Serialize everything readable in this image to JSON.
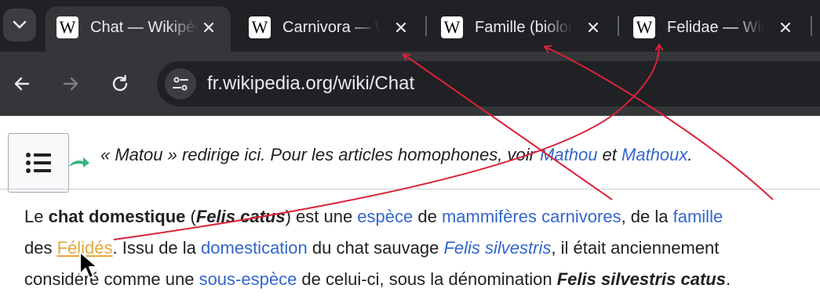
{
  "tabs": [
    {
      "title": "Chat — Wikipédia",
      "active": true
    },
    {
      "title": "Carnivora — Wikipédia",
      "active": false
    },
    {
      "title": "Famille (biologie) — Wikipédia",
      "active": false
    },
    {
      "title": "Felidae — Wikipédia",
      "active": false
    }
  ],
  "favicon_glyph": "W",
  "toolbar": {
    "url": "fr.wikipedia.org/wiki/Chat"
  },
  "hatnote": {
    "prefix": "« Matou » redirige ici. Pour les articles homophones, voir ",
    "link1": "Mathou",
    "mid": " et ",
    "link2": "Mathoux",
    "suffix": "."
  },
  "paragraph": {
    "l1_a": "Le ",
    "l1_b": "chat domestique",
    "l1_c": " (",
    "l1_d": "Felis catus",
    "l1_e": ") est une ",
    "l1_link1": "espèce",
    "l1_f": " de ",
    "l1_link2": "mammifères",
    "l1_g": " ",
    "l1_link3": "carnivores",
    "l1_h": ", de la ",
    "l1_link4": "famille",
    "l2_a": "des ",
    "l2_link1": "Félidés",
    "l2_b": ". Issu de la ",
    "l2_link2": "domestication",
    "l2_c": " du chat sauvage ",
    "l2_link3": "Felis silvestris",
    "l2_d": ", il était anciennement",
    "l3_a": "considéré comme une ",
    "l3_link1": "sous-espèce",
    "l3_b": " de celui-ci, sous la dénomination ",
    "l3_c": "Felis silvestris catus",
    "l3_d": "."
  },
  "colors": {
    "annotation_arrow": "#d9223a",
    "link": "#3366cc",
    "hovered_link": "#e5a83e"
  }
}
